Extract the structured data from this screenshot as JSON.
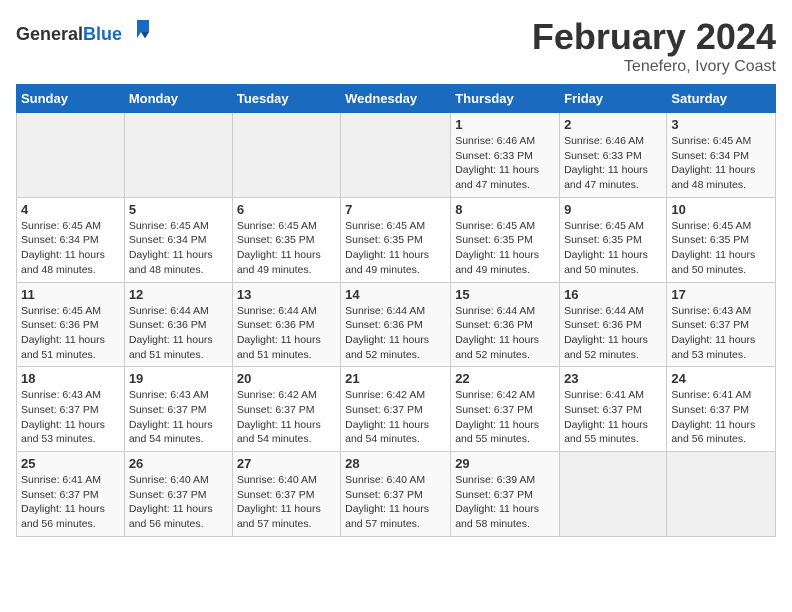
{
  "logo": {
    "general": "General",
    "blue": "Blue"
  },
  "title": "February 2024",
  "subtitle": "Tenefero, Ivory Coast",
  "headers": [
    "Sunday",
    "Monday",
    "Tuesday",
    "Wednesday",
    "Thursday",
    "Friday",
    "Saturday"
  ],
  "weeks": [
    [
      {
        "num": "",
        "info": "",
        "empty": true
      },
      {
        "num": "",
        "info": "",
        "empty": true
      },
      {
        "num": "",
        "info": "",
        "empty": true
      },
      {
        "num": "",
        "info": "",
        "empty": true
      },
      {
        "num": "1",
        "info": "Sunrise: 6:46 AM\nSunset: 6:33 PM\nDaylight: 11 hours\nand 47 minutes.",
        "empty": false
      },
      {
        "num": "2",
        "info": "Sunrise: 6:46 AM\nSunset: 6:33 PM\nDaylight: 11 hours\nand 47 minutes.",
        "empty": false
      },
      {
        "num": "3",
        "info": "Sunrise: 6:45 AM\nSunset: 6:34 PM\nDaylight: 11 hours\nand 48 minutes.",
        "empty": false
      }
    ],
    [
      {
        "num": "4",
        "info": "Sunrise: 6:45 AM\nSunset: 6:34 PM\nDaylight: 11 hours\nand 48 minutes.",
        "empty": false
      },
      {
        "num": "5",
        "info": "Sunrise: 6:45 AM\nSunset: 6:34 PM\nDaylight: 11 hours\nand 48 minutes.",
        "empty": false
      },
      {
        "num": "6",
        "info": "Sunrise: 6:45 AM\nSunset: 6:35 PM\nDaylight: 11 hours\nand 49 minutes.",
        "empty": false
      },
      {
        "num": "7",
        "info": "Sunrise: 6:45 AM\nSunset: 6:35 PM\nDaylight: 11 hours\nand 49 minutes.",
        "empty": false
      },
      {
        "num": "8",
        "info": "Sunrise: 6:45 AM\nSunset: 6:35 PM\nDaylight: 11 hours\nand 49 minutes.",
        "empty": false
      },
      {
        "num": "9",
        "info": "Sunrise: 6:45 AM\nSunset: 6:35 PM\nDaylight: 11 hours\nand 50 minutes.",
        "empty": false
      },
      {
        "num": "10",
        "info": "Sunrise: 6:45 AM\nSunset: 6:35 PM\nDaylight: 11 hours\nand 50 minutes.",
        "empty": false
      }
    ],
    [
      {
        "num": "11",
        "info": "Sunrise: 6:45 AM\nSunset: 6:36 PM\nDaylight: 11 hours\nand 51 minutes.",
        "empty": false
      },
      {
        "num": "12",
        "info": "Sunrise: 6:44 AM\nSunset: 6:36 PM\nDaylight: 11 hours\nand 51 minutes.",
        "empty": false
      },
      {
        "num": "13",
        "info": "Sunrise: 6:44 AM\nSunset: 6:36 PM\nDaylight: 11 hours\nand 51 minutes.",
        "empty": false
      },
      {
        "num": "14",
        "info": "Sunrise: 6:44 AM\nSunset: 6:36 PM\nDaylight: 11 hours\nand 52 minutes.",
        "empty": false
      },
      {
        "num": "15",
        "info": "Sunrise: 6:44 AM\nSunset: 6:36 PM\nDaylight: 11 hours\nand 52 minutes.",
        "empty": false
      },
      {
        "num": "16",
        "info": "Sunrise: 6:44 AM\nSunset: 6:36 PM\nDaylight: 11 hours\nand 52 minutes.",
        "empty": false
      },
      {
        "num": "17",
        "info": "Sunrise: 6:43 AM\nSunset: 6:37 PM\nDaylight: 11 hours\nand 53 minutes.",
        "empty": false
      }
    ],
    [
      {
        "num": "18",
        "info": "Sunrise: 6:43 AM\nSunset: 6:37 PM\nDaylight: 11 hours\nand 53 minutes.",
        "empty": false
      },
      {
        "num": "19",
        "info": "Sunrise: 6:43 AM\nSunset: 6:37 PM\nDaylight: 11 hours\nand 54 minutes.",
        "empty": false
      },
      {
        "num": "20",
        "info": "Sunrise: 6:42 AM\nSunset: 6:37 PM\nDaylight: 11 hours\nand 54 minutes.",
        "empty": false
      },
      {
        "num": "21",
        "info": "Sunrise: 6:42 AM\nSunset: 6:37 PM\nDaylight: 11 hours\nand 54 minutes.",
        "empty": false
      },
      {
        "num": "22",
        "info": "Sunrise: 6:42 AM\nSunset: 6:37 PM\nDaylight: 11 hours\nand 55 minutes.",
        "empty": false
      },
      {
        "num": "23",
        "info": "Sunrise: 6:41 AM\nSunset: 6:37 PM\nDaylight: 11 hours\nand 55 minutes.",
        "empty": false
      },
      {
        "num": "24",
        "info": "Sunrise: 6:41 AM\nSunset: 6:37 PM\nDaylight: 11 hours\nand 56 minutes.",
        "empty": false
      }
    ],
    [
      {
        "num": "25",
        "info": "Sunrise: 6:41 AM\nSunset: 6:37 PM\nDaylight: 11 hours\nand 56 minutes.",
        "empty": false
      },
      {
        "num": "26",
        "info": "Sunrise: 6:40 AM\nSunset: 6:37 PM\nDaylight: 11 hours\nand 56 minutes.",
        "empty": false
      },
      {
        "num": "27",
        "info": "Sunrise: 6:40 AM\nSunset: 6:37 PM\nDaylight: 11 hours\nand 57 minutes.",
        "empty": false
      },
      {
        "num": "28",
        "info": "Sunrise: 6:40 AM\nSunset: 6:37 PM\nDaylight: 11 hours\nand 57 minutes.",
        "empty": false
      },
      {
        "num": "29",
        "info": "Sunrise: 6:39 AM\nSunset: 6:37 PM\nDaylight: 11 hours\nand 58 minutes.",
        "empty": false
      },
      {
        "num": "",
        "info": "",
        "empty": true
      },
      {
        "num": "",
        "info": "",
        "empty": true
      }
    ]
  ]
}
